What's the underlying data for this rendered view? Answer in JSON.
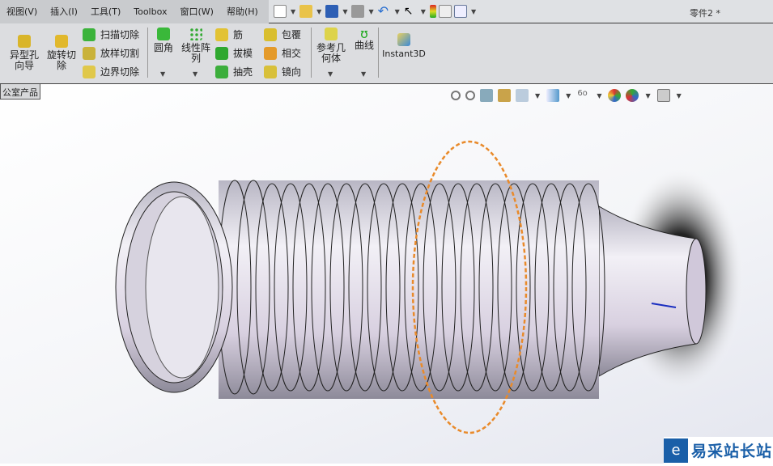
{
  "menus": [
    "视图(V)",
    "插入(I)",
    "工具(T)",
    "Toolbox",
    "窗口(W)",
    "帮助(H)"
  ],
  "document_title": "零件2 *",
  "ribbon": {
    "hole_wizard": "异型孔向导",
    "revolve_cut": "旋转切除",
    "sweep_cut": "扫描切除",
    "loft_cut": "放样切割",
    "boundary_cut": "边界切除",
    "fillet": "圆角",
    "linear_pattern": "线性阵列",
    "rib": "筋",
    "draft": "拔模",
    "shell": "抽壳",
    "wrap": "包覆",
    "intersect": "相交",
    "mirror": "镜向",
    "ref_geometry": "参考几何体",
    "curves": "曲线",
    "instant3d": "Instant3D"
  },
  "tab_label": "公室产品",
  "watermark": "易采站长站"
}
